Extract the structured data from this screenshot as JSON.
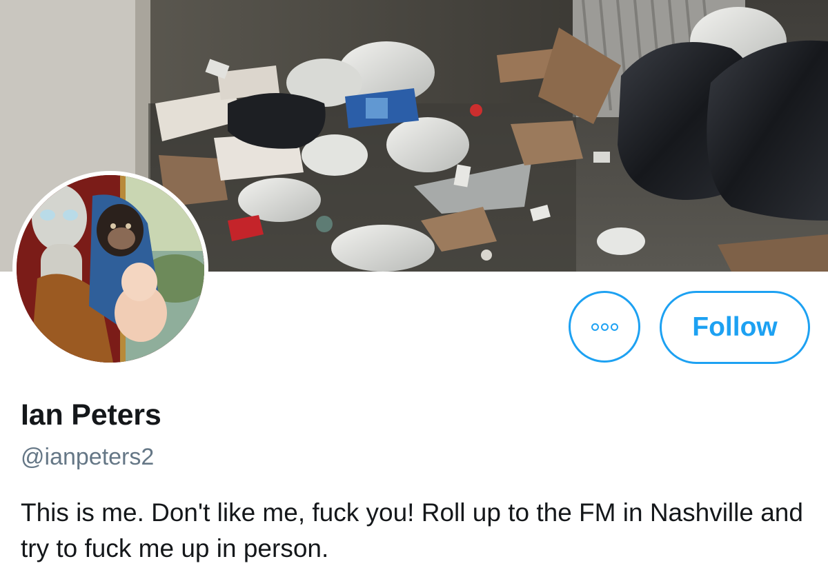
{
  "profile": {
    "display_name": "Ian Peters",
    "handle": "@ianpeters2",
    "bio": "This is me. Don't like me, fuck you! Roll up to the FM in Nashville and try to fuck me up in person."
  },
  "actions": {
    "follow_label": "Follow",
    "more_icon": "more-options-icon"
  },
  "banner": {
    "image_subject": "pile of trash bags, cans and cardboard against a wall"
  },
  "avatar": {
    "image_subject": "painting of an alien, a chimpanzee in a blue veil and a baby"
  },
  "colors": {
    "accent": "#1da1f2",
    "text_primary": "#14171a",
    "text_secondary": "#657786",
    "background": "#ffffff"
  }
}
